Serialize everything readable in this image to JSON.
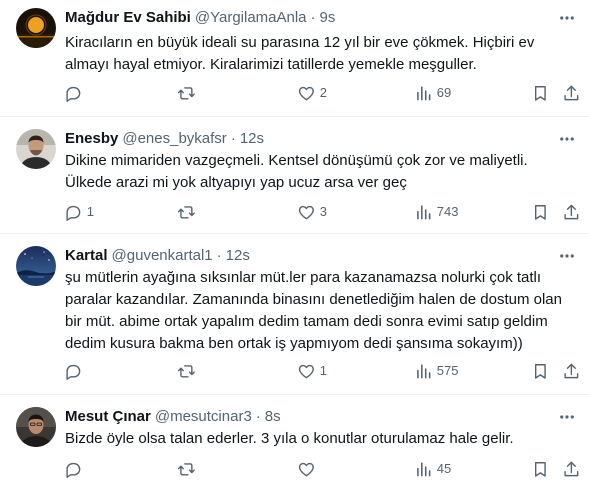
{
  "tweets": [
    {
      "name": "Mağdur Ev Sahibi",
      "handle": "@YargilamaAnla",
      "separator": "·",
      "time": "9s",
      "text": "Kiracıların en büyük ideali su parasına 12 yıl bir  eve çökmek. Hiçbiri ev\nalmayı hayal etmiyor. Kiralarimizi tatillerde yemekle meşguller.",
      "reply_count": "",
      "retweet_count": "",
      "like_count": "2",
      "view_count": "69",
      "avatar": "moon-night-avatar"
    },
    {
      "name": "Enesby",
      "handle": "@enes_bykafsr",
      "separator": "·",
      "time": "12s",
      "text": "Dikine mimariden vazgeçmeli. Kentsel dönüşümü çok zor ve maliyetli.\nÜlkede arazi mi yok altyapıyı yap ucuz arsa ver geç",
      "reply_count": "1",
      "retweet_count": "",
      "like_count": "3",
      "view_count": "743",
      "avatar": "man-photo-avatar"
    },
    {
      "name": "Kartal",
      "handle": "@guvenkartal1",
      "separator": "·",
      "time": "12s",
      "text": "şu mütlerin ayağına sıksınlar müt.ler para kazanamazsa nolurki çok tatlı\nparalar kazandılar. Zamanında binasını denetlediğim halen de dostum olan\nbir müt. abime ortak yapalım dedim tamam dedi sonra evimi satıp geldim\ndedim kusura bakma ben ortak iş yapmıyom dedi şansıma sokayım))",
      "reply_count": "",
      "retweet_count": "",
      "like_count": "1",
      "view_count": "575",
      "avatar": "night-sky-avatar"
    },
    {
      "name": "Mesut Çınar",
      "handle": "@mesutcinar3",
      "separator": "·",
      "time": "8s",
      "text": "Bizde öyle olsa talan ederler. 3 yıla o konutlar oturulamaz hale gelir.",
      "reply_count": "",
      "retweet_count": "",
      "like_count": "",
      "view_count": "45",
      "avatar": "man-dark-avatar"
    }
  ],
  "colors": {
    "text": "#0f1419",
    "secondary": "#536471",
    "divider": "#eff3f4"
  },
  "icons": [
    "reply-icon",
    "retweet-icon",
    "like-icon",
    "views-icon",
    "bookmark-icon",
    "share-icon",
    "more-icon"
  ]
}
